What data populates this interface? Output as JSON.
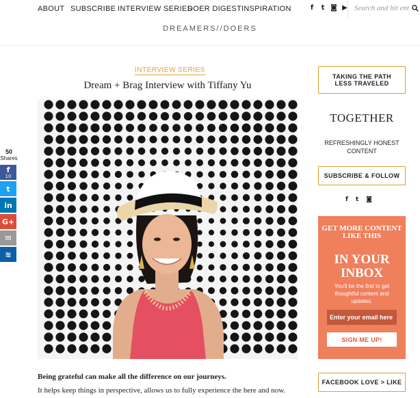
{
  "nav": {
    "items": [
      "ABOUT",
      "SUBSCRIBE",
      "INTERVIEW SERIES",
      "DOER DIGEST",
      "INSPIRATION"
    ],
    "social": [
      {
        "name": "facebook-icon",
        "glyph": "f"
      },
      {
        "name": "twitter-icon",
        "glyph": "t"
      },
      {
        "name": "instagram-icon",
        "glyph": "◙"
      },
      {
        "name": "youtube-icon",
        "glyph": "▶"
      }
    ],
    "search_placeholder": "Search and hit enter"
  },
  "brand": "DREAMERS//DOERS",
  "article": {
    "kicker": "INTERVIEW SERIES",
    "title": "Dream + Brag Interview with Tiffany Yu",
    "lead": "Being grateful can make all the difference on our journeys.",
    "body": "It helps keep things in perspective, allows us to fully experience the here and now."
  },
  "share": {
    "count": "50",
    "count_label": "Shares",
    "buttons": [
      {
        "name": "facebook-share-button",
        "glyph": "f",
        "count": "10",
        "color": "#3b5998"
      },
      {
        "name": "twitter-share-button",
        "glyph": "t",
        "count": "",
        "color": "#1da1f2"
      },
      {
        "name": "linkedin-share-button",
        "glyph": "in",
        "count": "",
        "color": "#0077b5"
      },
      {
        "name": "googleplus-share-button",
        "glyph": "G+",
        "count": "",
        "color": "#dd4b39"
      },
      {
        "name": "email-share-button",
        "glyph": "✉",
        "count": "",
        "color": "#999999"
      },
      {
        "name": "sumome-share-button",
        "glyph": "≋",
        "count": "",
        "color": "#0a5fa8"
      }
    ]
  },
  "sidebar": {
    "box1": "TAKING THE PATH LESS TRAVELED",
    "together": "TOGETHER",
    "together_sub": "REFRESHINGLY HONEST CONTENT",
    "subscribe": "SUBSCRIBE & FOLLOW",
    "social": [
      "f",
      "t",
      "◙"
    ],
    "promo": {
      "head": "GET MORE CONTENT LIKE THIS",
      "big": "IN YOUR INBOX",
      "text": "You'll be the first to get thoughtful content and updates.",
      "email_placeholder": "Enter your email here",
      "button": "SIGN ME UP!"
    },
    "facebook_box": "FACEBOOK LOVE > LIKE"
  },
  "colors": {
    "accent": "#e0a030",
    "promo": "#f07f5c"
  }
}
